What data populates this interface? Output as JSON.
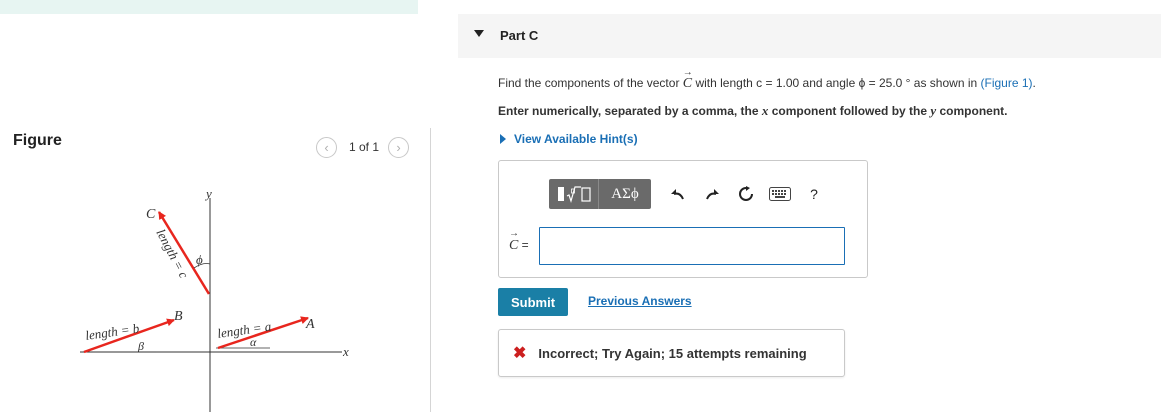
{
  "figure": {
    "title": "Figure",
    "pager_text": "1 of 1",
    "prev_icon": "chevron-left-icon",
    "next_icon": "chevron-right-icon",
    "labels": {
      "y_axis": "y",
      "x_axis": "x",
      "vec_c": "C",
      "vec_b": "B",
      "vec_a": "A",
      "len_c": "length = c",
      "len_b": "length = b",
      "len_a": "length = a",
      "angle_phi": "ϕ",
      "angle_beta": "β",
      "angle_alpha": "α"
    },
    "arrow_color": "#e8261e"
  },
  "part": {
    "title": "Part C",
    "question_prefix": "Find the components of the vector ",
    "question_vector": "C",
    "question_mid": " with length c = 1.00 and angle ϕ = 25.0 ° as shown in ",
    "question_link": "(Figure 1)",
    "question_suffix": ".",
    "instruction_a": "Enter numerically, separated by a comma, the ",
    "instruction_x": "x",
    "instruction_b": " component followed by the ",
    "instruction_y": "y",
    "instruction_c": " component.",
    "hints_label": "View Available Hint(s)"
  },
  "toolbar": {
    "greek_label": "ΑΣϕ",
    "help_label": "?",
    "icons": [
      "templates-icon",
      "greek-icon",
      "undo-icon",
      "redo-icon",
      "reset-icon",
      "keyboard-icon",
      "help-icon"
    ]
  },
  "answer": {
    "label_var": "C",
    "label_eq": " =",
    "value": ""
  },
  "actions": {
    "submit_label": "Submit",
    "previous_answers_label": "Previous Answers"
  },
  "feedback": {
    "text": "Incorrect; Try Again; 15 attempts remaining",
    "status_color": "#cc1f1f"
  }
}
